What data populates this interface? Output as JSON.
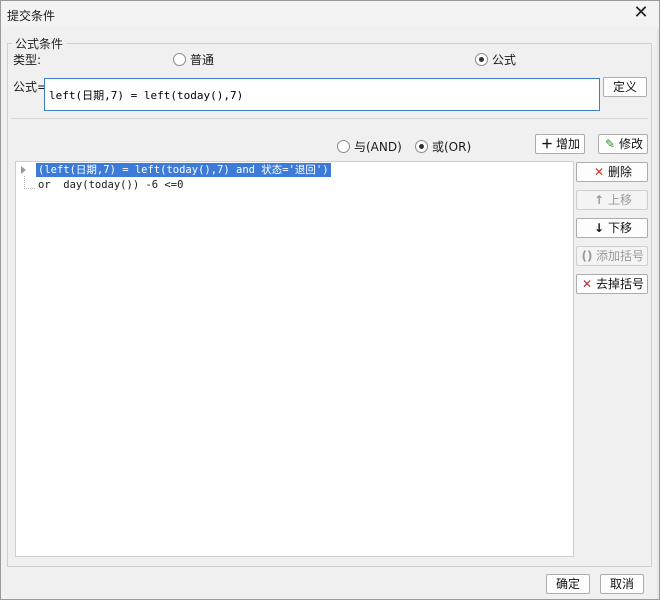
{
  "window": {
    "title": "提交条件"
  },
  "group": {
    "legend": "公式条件"
  },
  "type": {
    "label": "类型:",
    "options": [
      {
        "label": "普通",
        "checked": false
      },
      {
        "label": "公式",
        "checked": true
      }
    ]
  },
  "formula": {
    "label": "公式=",
    "value": "left(日期,7) = left(today(),7)",
    "define_label": "定义"
  },
  "logic": {
    "options": [
      {
        "label": "与(AND)",
        "checked": false
      },
      {
        "label": "或(OR)",
        "checked": true
      }
    ],
    "add_label": "增加",
    "modify_label": "修改"
  },
  "conditions": [
    {
      "text": "(left(日期,7) = left(today(),7) and 状态='退回')",
      "selected": true
    },
    {
      "text": "or  day(today()) -6 <=0",
      "selected": false
    }
  ],
  "side_buttons": {
    "delete_label": "删除",
    "up_label": "上移",
    "down_label": "下移",
    "add_paren_label": "添加括号",
    "remove_paren_label": "去掉括号"
  },
  "footer": {
    "ok_label": "确定",
    "cancel_label": "取消"
  },
  "colors": {
    "selection": "#3d7bd8",
    "input_border": "#3c7fc4",
    "delete_icon": "#d93025"
  },
  "icons": {
    "close": "close-icon",
    "add": "plus-icon",
    "modify": "edit-icon",
    "delete": "x-icon",
    "up": "arrow-up-icon",
    "down": "arrow-down-icon",
    "add_paren": "parentheses-icon",
    "remove_paren": "remove-parentheses-icon"
  }
}
